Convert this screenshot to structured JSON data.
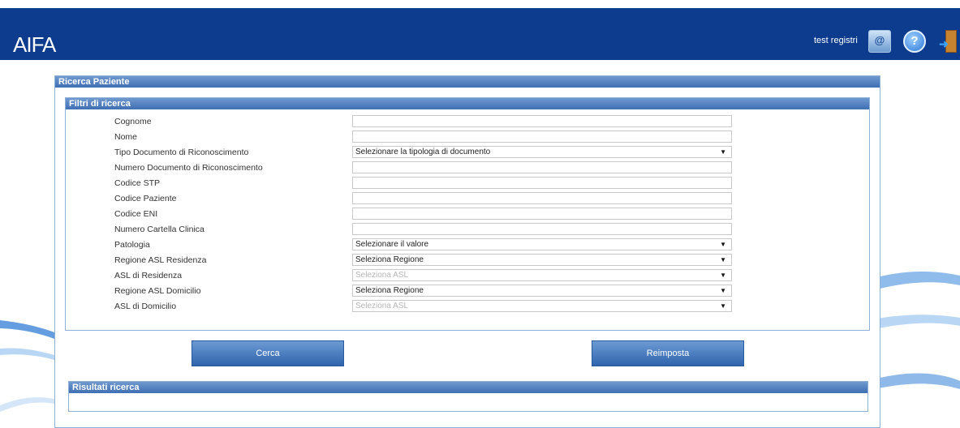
{
  "header": {
    "logo": "AIFA",
    "user": "test registri",
    "icons": [
      "mail-icon",
      "help-icon",
      "exit-icon"
    ]
  },
  "panel_title": "Ricerca Paziente",
  "filters": {
    "title": "Filtri di ricerca",
    "fields": [
      {
        "label": "Cognome",
        "type": "text",
        "value": ""
      },
      {
        "label": "Nome",
        "type": "text",
        "value": ""
      },
      {
        "label": "Tipo Documento di Riconoscimento",
        "type": "select",
        "value": "Selezionare la tipologia di documento"
      },
      {
        "label": "Numero Documento di Riconoscimento",
        "type": "text",
        "value": ""
      },
      {
        "label": "Codice STP",
        "type": "text",
        "value": ""
      },
      {
        "label": "Codice Paziente",
        "type": "text",
        "value": ""
      },
      {
        "label": "Codice ENI",
        "type": "text",
        "value": ""
      },
      {
        "label": "Numero Cartella Clinica",
        "type": "text",
        "value": ""
      },
      {
        "label": "Patologia",
        "type": "select",
        "value": "Selezionare il valore"
      },
      {
        "label": "Regione ASL Residenza",
        "type": "select",
        "value": "Seleziona Regione"
      },
      {
        "label": "ASL di Residenza",
        "type": "select",
        "value": "Seleziona ASL",
        "disabled": true
      },
      {
        "label": "Regione ASL Domicilio",
        "type": "select",
        "value": "Seleziona Regione"
      },
      {
        "label": "ASL di Domicilio",
        "type": "select",
        "value": "Seleziona ASL",
        "disabled": true
      }
    ]
  },
  "buttons": {
    "search": "Cerca",
    "reset": "Reimposta"
  },
  "results": {
    "title": "Risultati ricerca"
  },
  "colors": {
    "header_bg": "#0d3b8e",
    "bar_top": "#6f98cf",
    "bar_bottom": "#3f6fb4",
    "border": "#8fb0d6"
  }
}
